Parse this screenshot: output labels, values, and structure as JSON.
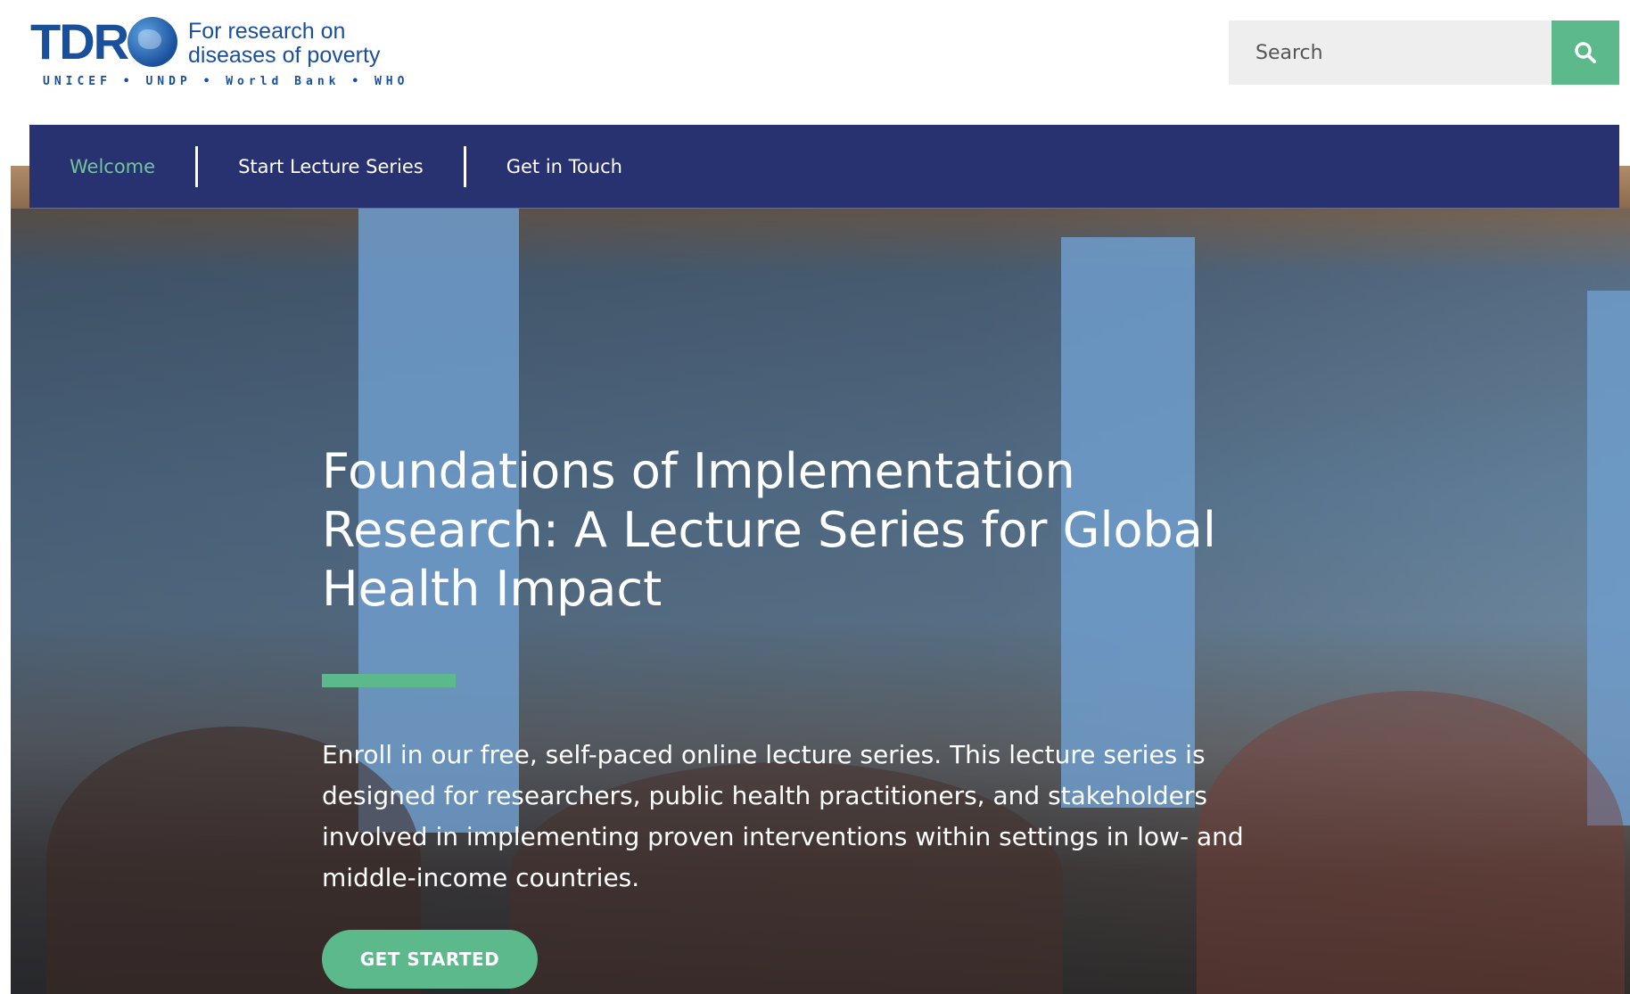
{
  "logo": {
    "wordmark": "TDR",
    "tagline_line1": "For research on",
    "tagline_line2": "diseases of poverty",
    "orgs": "UNICEF • UNDP • World Bank • WHO"
  },
  "search": {
    "placeholder": "Search",
    "icon": "search-icon"
  },
  "nav": {
    "items": [
      {
        "label": "Welcome",
        "active": true
      },
      {
        "label": "Start Lecture Series",
        "active": false
      },
      {
        "label": "Get in Touch",
        "active": false
      }
    ]
  },
  "hero": {
    "title": "Foundations of Implementation Research: A Lecture Series for Global Health Impact",
    "description": "Enroll in our free, self-paced online lecture series. This lecture series is designed for researchers, public health practitioners, and stakeholders involved in implementing proven interventions within settings in low- and middle-income countries.",
    "cta_label": "GET STARTED"
  },
  "colors": {
    "nav_bg": "#283270",
    "accent_green": "#5cb98b",
    "active_nav": "#6fc79a",
    "logo_blue": "#1a4f9c"
  }
}
